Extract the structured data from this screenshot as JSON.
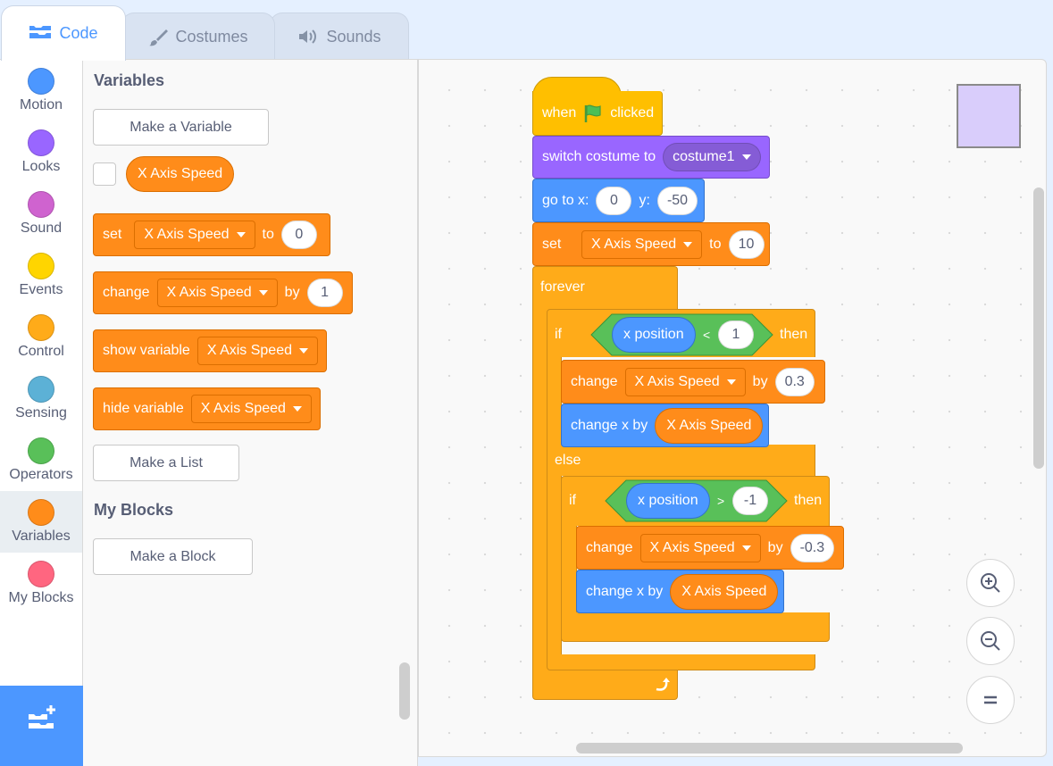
{
  "tabs": [
    {
      "label": "Code",
      "icon": "code-icon"
    },
    {
      "label": "Costumes",
      "icon": "brush-icon"
    },
    {
      "label": "Sounds",
      "icon": "speaker-icon"
    }
  ],
  "categories": [
    {
      "label": "Motion",
      "color": "#4c97ff"
    },
    {
      "label": "Looks",
      "color": "#9966ff"
    },
    {
      "label": "Sound",
      "color": "#cf63cf"
    },
    {
      "label": "Events",
      "color": "#ffd500"
    },
    {
      "label": "Control",
      "color": "#ffab19"
    },
    {
      "label": "Sensing",
      "color": "#5cb1d6"
    },
    {
      "label": "Operators",
      "color": "#59c059"
    },
    {
      "label": "Variables",
      "color": "#ff8c1a",
      "selected": true
    },
    {
      "label": "My Blocks",
      "color": "#ff6680"
    }
  ],
  "palette": {
    "variables_heading": "Variables",
    "make_variable": "Make a Variable",
    "variable_name": "X Axis Speed",
    "set_block": {
      "word": "set",
      "var": "X Axis Speed",
      "to": "to",
      "value": "0"
    },
    "change_block": {
      "word": "change",
      "var": "X Axis Speed",
      "by": "by",
      "value": "1"
    },
    "show_block": {
      "word": "show variable",
      "var": "X Axis Speed"
    },
    "hide_block": {
      "word": "hide variable",
      "var": "X Axis Speed"
    },
    "make_list": "Make a List",
    "myblocks_heading": "My Blocks",
    "make_block": "Make a Block"
  },
  "script": {
    "when": "when",
    "clicked": "clicked",
    "switch_costume": "switch costume to",
    "costume": "costume1",
    "goto": "go to x:",
    "goto_x": "0",
    "y_label": "y:",
    "goto_y": "-50",
    "set_word": "set",
    "set_var": "X Axis Speed",
    "set_to": "to",
    "set_value": "10",
    "forever": "forever",
    "if1": "if",
    "xpos1": "x position",
    "lt": "<",
    "cmp1": "1",
    "then1": "then",
    "change1_word": "change",
    "change1_var": "X Axis Speed",
    "change1_by": "by",
    "change1_value": "0.3",
    "changex1": "change x by",
    "changex1_var": "X Axis Speed",
    "else": "else",
    "if2": "if",
    "xpos2": "x position",
    "gt": ">",
    "cmp2": "-1",
    "then2": "then",
    "change2_word": "change",
    "change2_var": "X Axis Speed",
    "change2_by": "by",
    "change2_value": "-0.3",
    "changex2": "change x by",
    "changex2_var": "X Axis Speed"
  },
  "zoom": {
    "zoom_in": "zoom-in-icon",
    "zoom_out": "zoom-out-icon",
    "reset": "reset-zoom-icon"
  }
}
